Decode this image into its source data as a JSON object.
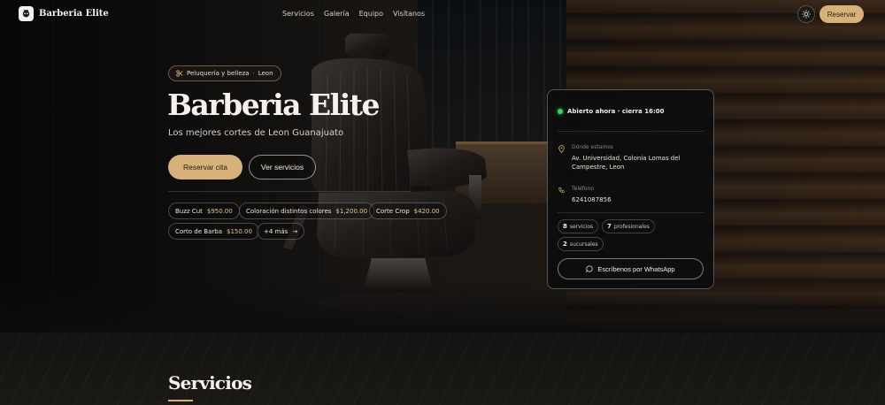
{
  "brand": {
    "name": "Barberia Elite"
  },
  "nav": {
    "links": [
      "Servicios",
      "Galería",
      "Equipo",
      "Visítanos"
    ],
    "reserve_label": "Reservar"
  },
  "hero": {
    "category": "Peluquería y belleza",
    "city": "Leon",
    "title": "Barberia Elite",
    "subtitle": "Los mejores cortes de Leon Guanajuato",
    "primary_cta": "Reservar cita",
    "secondary_cta": "Ver servicios",
    "services": [
      {
        "name": "Buzz Cut",
        "price": "$950.00"
      },
      {
        "name": "Coloración distintos colores",
        "price": "$1,200.00"
      },
      {
        "name": "Corte Crop",
        "price": "$420.00"
      },
      {
        "name": "Corto de Barba",
        "price": "$150.00"
      }
    ],
    "more_label": "+4 más"
  },
  "info_card": {
    "status": "Abierto ahora · cierra 16:00",
    "location_label": "Dónde estamos",
    "address": "Av. Universidad, Colonia Lomas del Campestre, Leon",
    "phone_label": "Teléfono",
    "phone": "6241087856",
    "stats": [
      {
        "count": "8",
        "label": "servicios"
      },
      {
        "count": "7",
        "label": "profesionales"
      },
      {
        "count": "2",
        "label": "sucursales"
      }
    ],
    "whatsapp_label": "Escríbenos por WhatsApp"
  },
  "services_section": {
    "title": "Servicios"
  },
  "colors": {
    "accent": "#d6b27a",
    "background": "#0d0d0e",
    "status_open": "#3ccf5b"
  }
}
